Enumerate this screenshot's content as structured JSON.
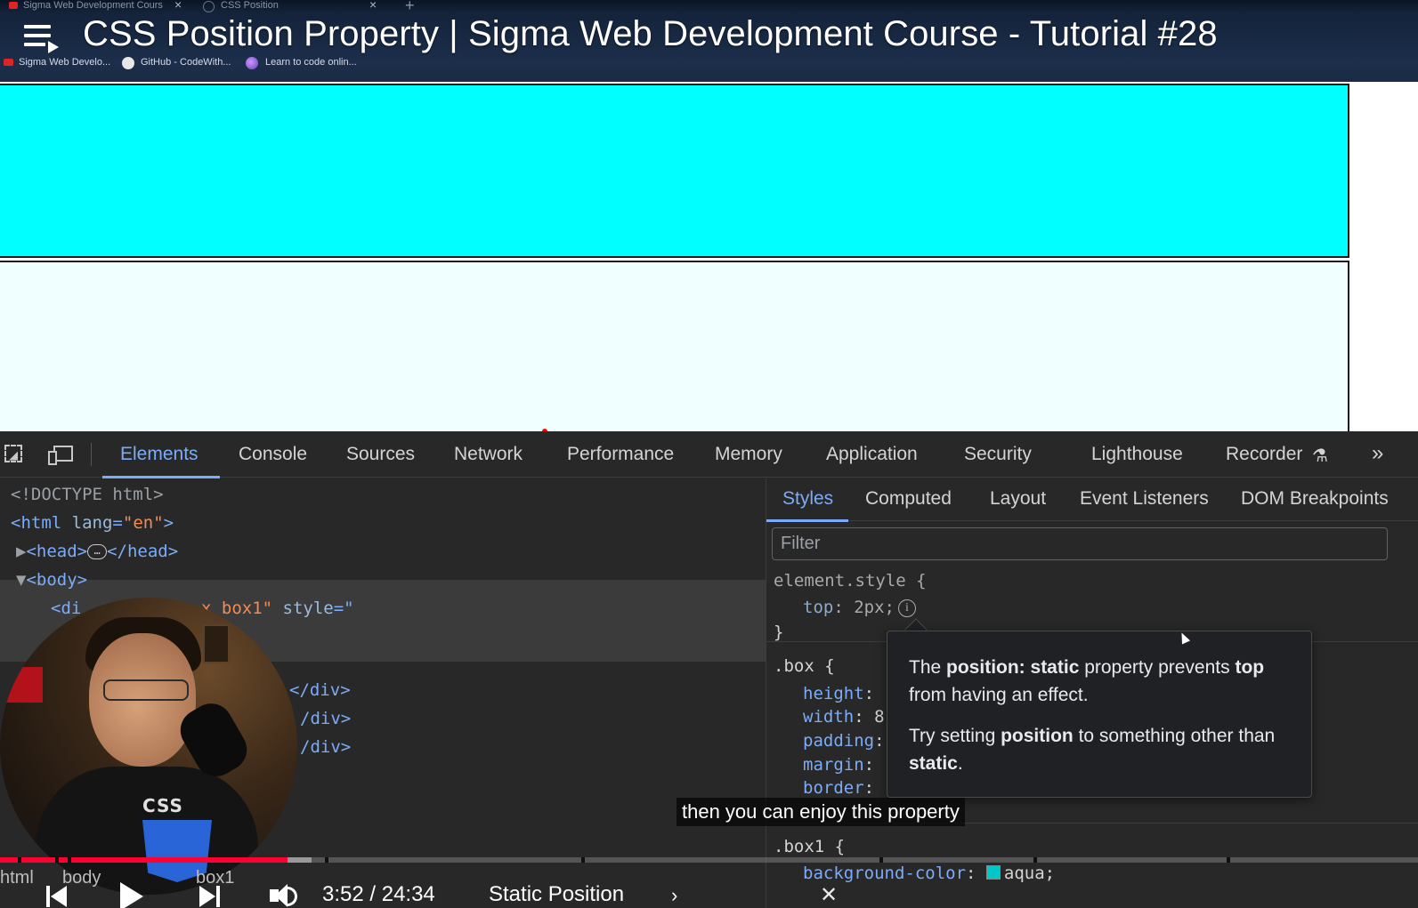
{
  "browser": {
    "tabs": [
      {
        "label": "Sigma Web Development Cours"
      },
      {
        "label": "CSS Position"
      }
    ],
    "new_tab_label": "+",
    "tab_close": "×",
    "bookmarks": [
      {
        "label": "Sigma Web Develo..."
      },
      {
        "label": "GitHub - CodeWith..."
      },
      {
        "label": "Learn to code onlin..."
      }
    ]
  },
  "video": {
    "title": "CSS Position Property | Sigma Web Development Course - Tutorial #28",
    "caption": "then you can enjoy this property",
    "time_display": "3:52 / 24:34",
    "chapter": "Static Position",
    "chapter_chevron": "›",
    "progress_fraction": 0.203,
    "buffered_fraction": 0.22,
    "chapter_gaps_fraction": [
      0.0125,
      0.039,
      0.048,
      0.229,
      0.41,
      0.62,
      0.729,
      0.865
    ],
    "presenter_shirt_text": "CSS"
  },
  "page": {
    "box1_color": "#00ffff",
    "box2_color": "#f0ffff"
  },
  "devtools": {
    "tabs": [
      "Elements",
      "Console",
      "Sources",
      "Network",
      "Performance",
      "Memory",
      "Application",
      "Security",
      "Lighthouse",
      "Recorder"
    ],
    "active_tab": "Elements",
    "more_tabs": "»",
    "elements": {
      "doctype": "<!DOCTYPE html>",
      "html_open": "<html",
      "html_attr": "lang",
      "html_val": "\"en\"",
      "html_close_angle": ">",
      "head_open": "<head>",
      "head_close": "</head>",
      "ellipsis": "…",
      "body_open": "<body>",
      "div_partial": "<di",
      "div_partial_val": "x box1\"",
      "style_attr": "style",
      "style_eq": "=\"",
      "div_close_1": "</div>",
      "div_close_2": "/div>",
      "div_close_3": "/div>"
    },
    "styles": {
      "sub_tabs": [
        "Styles",
        "Computed",
        "Layout",
        "Event Listeners",
        "DOM Breakpoints"
      ],
      "active_sub_tab": "Styles",
      "filter_placeholder": "Filter",
      "element_style_selector": "element.style {",
      "element_style_prop": "top",
      "element_style_val": "2px;",
      "info_icon": "i",
      "close_brace": "}",
      "box_selector": ".box {",
      "box_props": [
        {
          "name": "height",
          "value": ""
        },
        {
          "name": "width",
          "value": "8"
        },
        {
          "name": "padding",
          "value": ""
        },
        {
          "name": "margin",
          "value": ""
        },
        {
          "name": "border",
          "value": ""
        }
      ],
      "box1_selector": ".box1 {",
      "box1_prop": "background-color",
      "box1_val": "aqua;",
      "box1_swatch_color": "#00c8c8"
    },
    "tooltip": {
      "line1_pre": "The ",
      "line1_bold1": "position: static",
      "line1_mid": " property prevents ",
      "line1_bold2": "top",
      "line1_post": " from having an effect.",
      "line2_pre": "Try setting ",
      "line2_bold1": "position",
      "line2_mid": " to something other than ",
      "line2_bold2": "static",
      "line2_post": "."
    },
    "breadcrumb": [
      "html",
      "body",
      "box1"
    ]
  }
}
